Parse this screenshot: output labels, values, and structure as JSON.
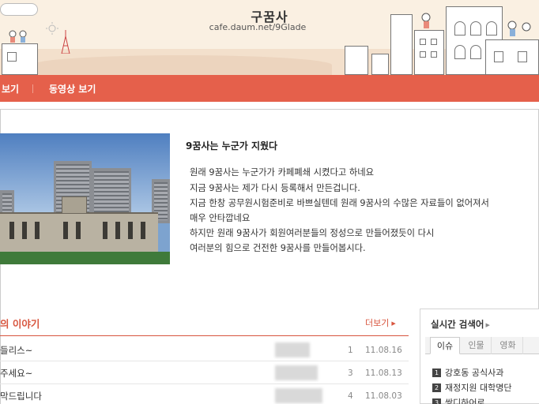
{
  "header": {
    "title": "구꿈사",
    "url": "cafe.daum.net/9Glade"
  },
  "nav": {
    "items": [
      {
        "label": "보기"
      },
      {
        "label": "동영상 보기"
      }
    ]
  },
  "intro": {
    "title": "9꿈사는 누군가 지웠다",
    "lines": [
      "원래 9꿈사는 누군가가 카페폐쇄 시켰다고 하네요",
      "지금 9꿈사는 제가 다시 등록해서 만든겁니다.",
      "지금 한창 공무원시험준비로 바쁘실텐데 원래 9꿈사의 수많은 자료들이 없어져서",
      "매우 안타깝네요",
      "하지만 원래 9꿈사가 회원여러분들의 정성으로 만들어졌듯이 다시",
      "여러분의 힘으로 건전한 9꿈사를 만들어봅시다."
    ]
  },
  "board": {
    "title": "의 이야기",
    "more_label": "더보기",
    "rows": [
      {
        "subject": "들리스~",
        "count": "1",
        "date": "11.08.16"
      },
      {
        "subject": "주세요~",
        "count": "3",
        "date": "11.08.13"
      },
      {
        "subject": "막드립니다",
        "count": "4",
        "date": "11.08.03"
      }
    ]
  },
  "realtime": {
    "title": "실시간 검색어",
    "tabs": [
      {
        "label": "이슈",
        "active": true
      },
      {
        "label": "인물",
        "active": false
      },
      {
        "label": "영화",
        "active": false
      }
    ],
    "items": [
      {
        "rank": "1",
        "text": "강호동 공식사과"
      },
      {
        "rank": "2",
        "text": "재정지원 대학명단"
      },
      {
        "rank": "3",
        "text": "쌍디하어로"
      }
    ]
  },
  "colors": {
    "accent": "#e5604b",
    "banner_bg": "#faf0e2",
    "link_red": "#d8553e"
  }
}
